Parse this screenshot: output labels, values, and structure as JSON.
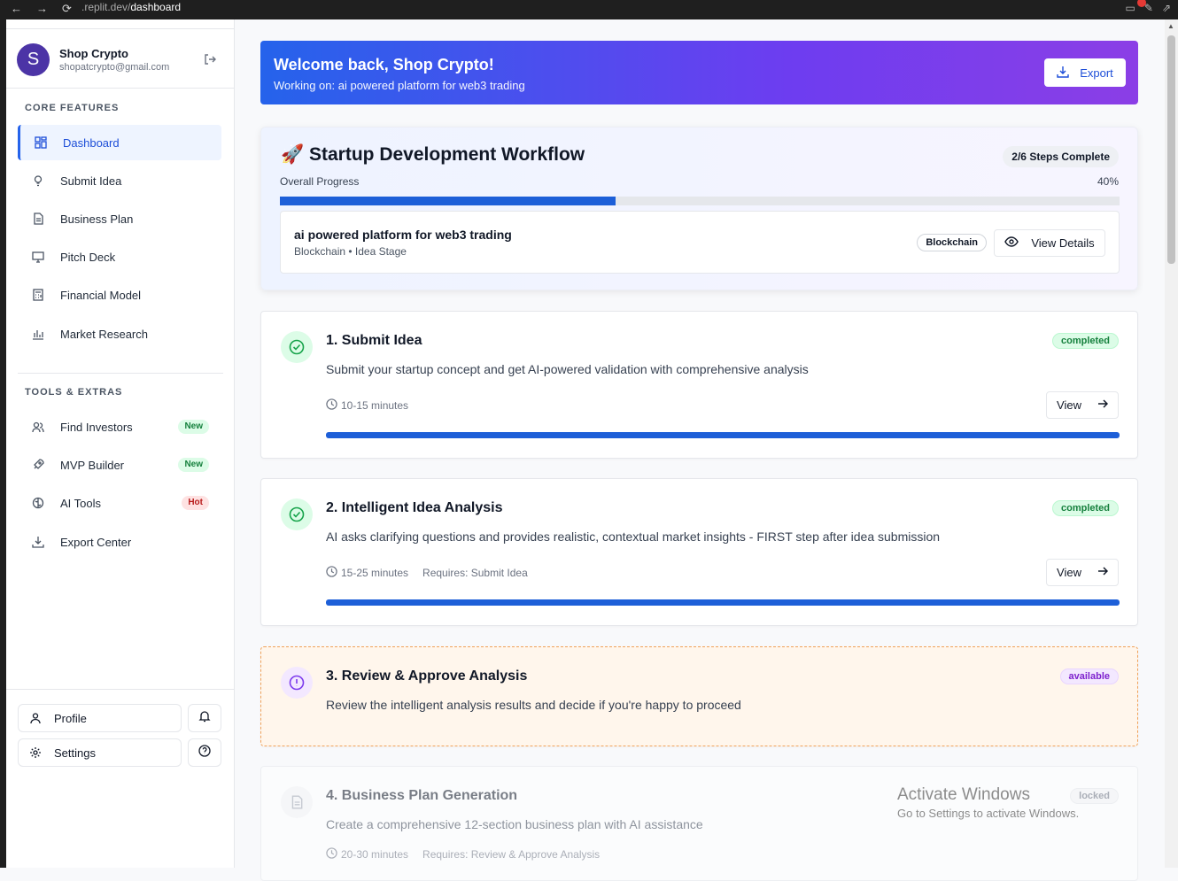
{
  "browser": {
    "url_prefix": ".replit.dev/",
    "url_path": "dashboard"
  },
  "user": {
    "initial": "S",
    "name": "Shop Crypto",
    "email": "shopatcrypto@gmail.com"
  },
  "sidebar": {
    "core_title": "CORE FEATURES",
    "core_items": [
      {
        "label": "Dashboard",
        "icon": "dashboard-icon",
        "active": true
      },
      {
        "label": "Submit Idea",
        "icon": "lightbulb-icon"
      },
      {
        "label": "Business Plan",
        "icon": "document-icon"
      },
      {
        "label": "Pitch Deck",
        "icon": "presentation-icon"
      },
      {
        "label": "Financial Model",
        "icon": "calculator-icon"
      },
      {
        "label": "Market Research",
        "icon": "bar-chart-icon"
      }
    ],
    "tools_title": "TOOLS & EXTRAS",
    "tools_items": [
      {
        "label": "Find Investors",
        "icon": "users-icon",
        "tag": "New"
      },
      {
        "label": "MVP Builder",
        "icon": "rocket-icon",
        "tag": "New"
      },
      {
        "label": "AI Tools",
        "icon": "brain-icon",
        "tag": "Hot"
      },
      {
        "label": "Export Center",
        "icon": "download-icon"
      }
    ],
    "profile_label": "Profile",
    "settings_label": "Settings"
  },
  "welcome": {
    "title": "Welcome back, Shop Crypto!",
    "subtitle": "Working on: ai powered platform for web3 trading",
    "export_label": "Export"
  },
  "workflow": {
    "emoji": "🚀",
    "title": "Startup Development Workflow",
    "steps_complete": "2/6 Steps Complete",
    "progress_label": "Overall Progress",
    "progress_text": "40%",
    "progress_value": 0.4,
    "project": {
      "name": "ai powered platform for web3 trading",
      "sub": "Blockchain • Idea Stage",
      "chip": "Blockchain",
      "view_details": "View Details"
    }
  },
  "steps": [
    {
      "title": "1. Submit Idea",
      "desc": "Submit your startup concept and get AI-powered validation with comprehensive analysis",
      "time": "10-15 minutes",
      "requires": "",
      "status": "completed",
      "view": "View",
      "progress": 1
    },
    {
      "title": "2. Intelligent Idea Analysis",
      "desc": "AI asks clarifying questions and provides realistic, contextual market insights - FIRST step after idea submission",
      "time": "15-25 minutes",
      "requires": "Requires: Submit Idea",
      "status": "completed",
      "view": "View",
      "progress": 1
    },
    {
      "title": "3. Review & Approve Analysis",
      "desc": "Review the intelligent analysis results and decide if you're happy to proceed",
      "status": "available"
    },
    {
      "title": "4. Business Plan Generation",
      "desc": "Create a comprehensive 12-section business plan with AI assistance",
      "time": "20-30 minutes",
      "requires": "Requires: Review & Approve Analysis",
      "status": "locked"
    }
  ],
  "watermark": {
    "line1": "Activate Windows",
    "line2": "Go to Settings to activate Windows."
  }
}
